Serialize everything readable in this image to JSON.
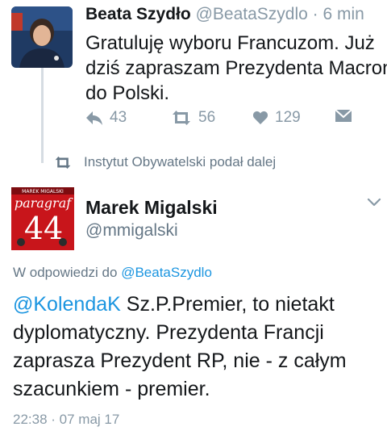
{
  "tweet1": {
    "author_name": "Beata Szydło",
    "handle": "@BeataSzydlo",
    "separator": "·",
    "time": "6 min",
    "text": "Gratuluję wyboru Francuzom. Już dziś zapraszam Prezydenta Macron do Polski.",
    "actions": {
      "reply_icon": "reply-icon",
      "reply_count": "43",
      "retweet_icon": "retweet-icon",
      "retweet_count": "56",
      "like_icon": "heart-icon",
      "like_count": "129",
      "dm_icon": "envelope-icon"
    }
  },
  "retweet_notice": {
    "icon": "retweet-icon",
    "text": "Instytut Obywatelski podał dalej"
  },
  "tweet2": {
    "author_name": "Marek Migalski",
    "handle": "@mmigalski",
    "menu_icon": "chevron-down-icon",
    "avatar": {
      "top_text": "MAREK MIGALSKI",
      "title": "paragraf",
      "number": "44"
    },
    "reply_prefix": "W odpowiedzi do",
    "reply_handle": "@BeataSzydlo",
    "mention": "@KolendaK",
    "text": "Sz.P.Premier, to nietakt dyplomatyczny. Prezydenta Francji zaprasza Prezydent RP, nie - z całym szacunkiem - premier.",
    "timestamp": "22:38 · 07 maj 17"
  },
  "colors": {
    "link": "#1b95e0",
    "muted": "#8899a6",
    "text": "#14171a",
    "avatar2_bg": "#c8151b"
  }
}
